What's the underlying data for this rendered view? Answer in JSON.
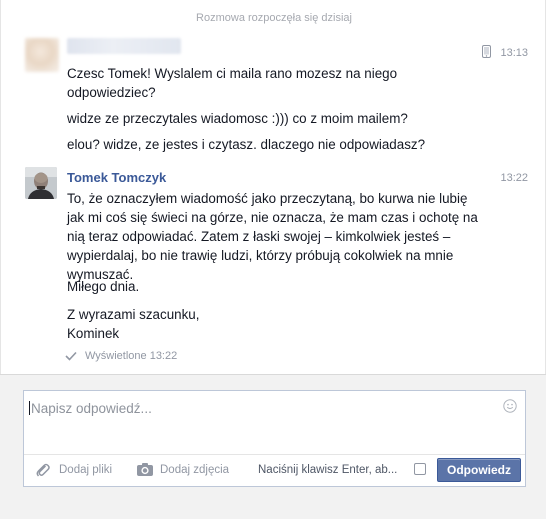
{
  "thread": {
    "started_label": "Rozmowa rozpoczęła się dzisiaj",
    "messages": [
      {
        "sender": "",
        "time": "13:13",
        "paragraphs": [
          "Czesc Tomek! Wyslalem ci maila rano mozesz na niego odpowiedziec?",
          "widze ze przeczytales wiadomosc :))) co z moim mailem?",
          "elou? widze, ze jestes i czytasz. dlaczego nie odpowiadasz?"
        ]
      },
      {
        "sender": "Tomek Tomczyk",
        "time": "13:22",
        "paragraphs": [
          "To, że oznaczyłem wiadomość jako przeczytaną, bo kurwa nie lubię jak mi coś się świeci na górze, nie oznacza, że mam czas i ochotę na nią teraz odpowiadać. Zatem z łaski swojej – kimkolwiek jesteś – wypierdalaj, bo nie trawię ludzi, którzy próbują cokolwiek na mnie wymuszać.",
          "Miłego dnia.",
          "Z wyrazami szacunku,",
          "Kominek"
        ]
      }
    ],
    "seen_label": "Wyświetlone 13:22"
  },
  "composer": {
    "placeholder": "Napisz odpowiedź...",
    "add_files": "Dodaj pliki",
    "add_photos": "Dodaj zdjęcia",
    "enter_hint": "Naciśnij klawisz Enter, ab...",
    "reply_button": "Odpowiedz"
  },
  "colors": {
    "link": "#3b5998",
    "button": "#5b74a8",
    "muted": "#9197a3"
  }
}
